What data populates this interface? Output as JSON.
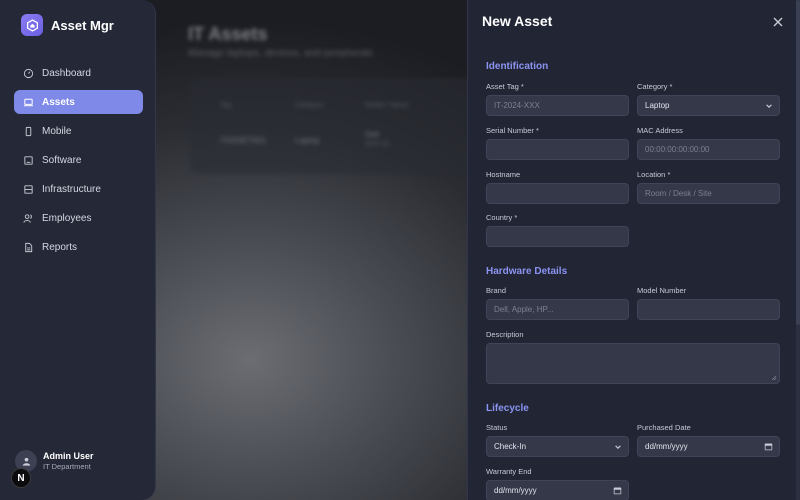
{
  "app": {
    "name": "Asset Mgr"
  },
  "background": {
    "title": "IT Assets",
    "subtitle": "Manage laptops, devices, and peripherals",
    "table_headers": [
      "Tag",
      "Category",
      "Model / Name"
    ],
    "row": {
      "tag": "ITASSET001",
      "category": "Laptop",
      "model": "Dell",
      "model_sub": "XPS 15"
    }
  },
  "sidebar": {
    "items": [
      {
        "label": "Dashboard",
        "icon": "dashboard-icon"
      },
      {
        "label": "Assets",
        "icon": "laptop-icon",
        "active": true
      },
      {
        "label": "Mobile",
        "icon": "mobile-icon"
      },
      {
        "label": "Software",
        "icon": "software-icon"
      },
      {
        "label": "Infrastructure",
        "icon": "server-icon"
      },
      {
        "label": "Employees",
        "icon": "employees-icon"
      },
      {
        "label": "Reports",
        "icon": "reports-icon"
      }
    ],
    "user": {
      "name": "Admin User",
      "department": "IT Department"
    },
    "badge": "N"
  },
  "panel": {
    "title": "New Asset",
    "sections": {
      "identification": "Identification",
      "hardware": "Hardware Details",
      "lifecycle": "Lifecycle"
    },
    "fields": {
      "asset_tag": {
        "label": "Asset Tag *",
        "placeholder": "IT-2024-XXX"
      },
      "category": {
        "label": "Category *",
        "value": "Laptop"
      },
      "serial": {
        "label": "Serial Number *",
        "value": ""
      },
      "mac": {
        "label": "MAC Address",
        "placeholder": "00:00:00:00:00:00"
      },
      "hostname": {
        "label": "Hostname",
        "value": ""
      },
      "location": {
        "label": "Location *",
        "placeholder": "Room / Desk / Site"
      },
      "country": {
        "label": "Country *",
        "value": ""
      },
      "brand": {
        "label": "Brand",
        "placeholder": "Dell, Apple, HP..."
      },
      "model_number": {
        "label": "Model Number",
        "value": ""
      },
      "description": {
        "label": "Description",
        "value": ""
      },
      "status": {
        "label": "Status",
        "value": "Check-In"
      },
      "purchased": {
        "label": "Purchased Date",
        "placeholder": "dd/mm/yyyy"
      },
      "warranty": {
        "label": "Warranty End",
        "placeholder": "dd/mm/yyyy"
      }
    }
  },
  "colors": {
    "accent": "#8b94f2",
    "active_nav": "#7f89e8",
    "panel_bg": "#222534",
    "sidebar_bg": "#252837"
  }
}
